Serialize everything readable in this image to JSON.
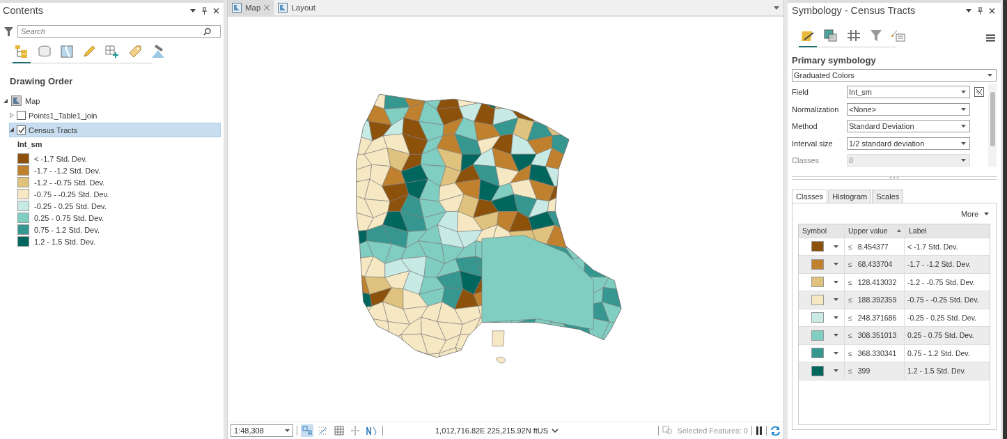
{
  "contents": {
    "title": "Contents",
    "search": {
      "placeholder": "Search"
    },
    "view_tabs": [
      {
        "kind": "drawing-order",
        "selected": true
      },
      {
        "kind": "data-source",
        "selected": false
      },
      {
        "kind": "selection",
        "selected": false
      },
      {
        "kind": "editing",
        "selected": false
      },
      {
        "kind": "snapping",
        "selected": false
      },
      {
        "kind": "labeling",
        "selected": false
      },
      {
        "kind": "perspective",
        "selected": false
      }
    ],
    "heading": "Drawing Order",
    "tree": [
      {
        "label": "Map",
        "expanded": true,
        "children": [
          {
            "label": "Points1_Table1_join",
            "checked": false,
            "expanded": false,
            "selected": false
          },
          {
            "label": "Census Tracts",
            "checked": true,
            "expanded": true,
            "selected": true
          }
        ]
      }
    ],
    "legend": {
      "field": "Int_sm",
      "classes": [
        {
          "label": "< -1.7 Std. Dev.",
          "color": "#8c510a"
        },
        {
          "label": "-1.7 - -1.2 Std. Dev.",
          "color": "#bf812d"
        },
        {
          "label": "-1.2 - -0.75 Std. Dev.",
          "color": "#dfc27d"
        },
        {
          "label": "-0.75 - -0.25 Std. Dev.",
          "color": "#f6e8c3"
        },
        {
          "label": "-0.25 - 0.25 Std. Dev.",
          "color": "#c7eae5"
        },
        {
          "label": "0.25 - 0.75 Std. Dev.",
          "color": "#80cdc1"
        },
        {
          "label": "0.75 - 1.2 Std. Dev.",
          "color": "#35978f"
        },
        {
          "label": "1.2 - 1.5 Std. Dev.",
          "color": "#01665e"
        }
      ]
    }
  },
  "map_view": {
    "tabs": [
      {
        "label": "Map",
        "selected": true,
        "closable": true
      },
      {
        "label": "Layout",
        "selected": false,
        "closable": false
      }
    ],
    "status_bar": {
      "scale": "1:48,308",
      "tools": [
        {
          "kind": "pan",
          "selected": true
        },
        {
          "kind": "grid",
          "selected": false
        },
        {
          "kind": "table",
          "selected": false
        },
        {
          "kind": "snap",
          "selected": false
        },
        {
          "kind": "north",
          "selected": false
        }
      ],
      "coordinates": "1,012,716.82E 225,215.92N ftUS",
      "selected_features": "Selected Features: 0"
    }
  },
  "symbology": {
    "title": "Symbology - Census Tracts",
    "view_tabs": [
      {
        "kind": "primary",
        "selected": true
      },
      {
        "kind": "vary",
        "selected": false
      },
      {
        "kind": "grid",
        "selected": false
      },
      {
        "kind": "filter",
        "selected": false
      },
      {
        "kind": "feature",
        "selected": false
      }
    ],
    "section": "Primary symbology",
    "renderer": "Graduated Colors",
    "fields": [
      {
        "label": "Field",
        "value": "Int_sm",
        "disabled": false,
        "expression": true
      },
      {
        "label": "Normalization",
        "value": "<None>",
        "disabled": false,
        "expression": false
      },
      {
        "label": "Method",
        "value": "Standard Deviation",
        "disabled": false,
        "expression": false
      },
      {
        "label": "Interval size",
        "value": "1/2 standard deviation",
        "disabled": false,
        "expression": false
      },
      {
        "label": "Classes",
        "value": "8",
        "disabled": true,
        "expression": false
      }
    ],
    "tabs": [
      {
        "label": "Classes",
        "selected": true
      },
      {
        "label": "Histogram",
        "selected": false
      },
      {
        "label": "Scales",
        "selected": false
      }
    ],
    "more": "More",
    "columns": [
      "Symbol",
      "Upper value",
      "Label"
    ],
    "rows": [
      {
        "color": "#8c510a",
        "operator": "≤",
        "upper": "8.454377",
        "label": "< -1.7 Std. Dev."
      },
      {
        "color": "#bf812d",
        "operator": "≤",
        "upper": "68.433704",
        "label": "-1.7 - -1.2 Std. Dev."
      },
      {
        "color": "#dfc27d",
        "operator": "≤",
        "upper": "128.413032",
        "label": "-1.2 - -0.75 Std. Dev."
      },
      {
        "color": "#f6e8c3",
        "operator": "≤",
        "upper": "188.392359",
        "label": "-0.75 - -0.25 Std. Dev."
      },
      {
        "color": "#c7eae5",
        "operator": "≤",
        "upper": "248.371686",
        "label": "-0.25 - 0.25 Std. Dev."
      },
      {
        "color": "#80cdc1",
        "operator": "≤",
        "upper": "308.351013",
        "label": "0.25 - 0.75 Std. Dev."
      },
      {
        "color": "#35978f",
        "operator": "≤",
        "upper": "368.330341",
        "label": "0.75 - 1.2 Std. Dev."
      },
      {
        "color": "#01665e",
        "operator": "≤",
        "upper": "399",
        "label": "1.2 - 1.5 Std. Dev."
      }
    ]
  }
}
